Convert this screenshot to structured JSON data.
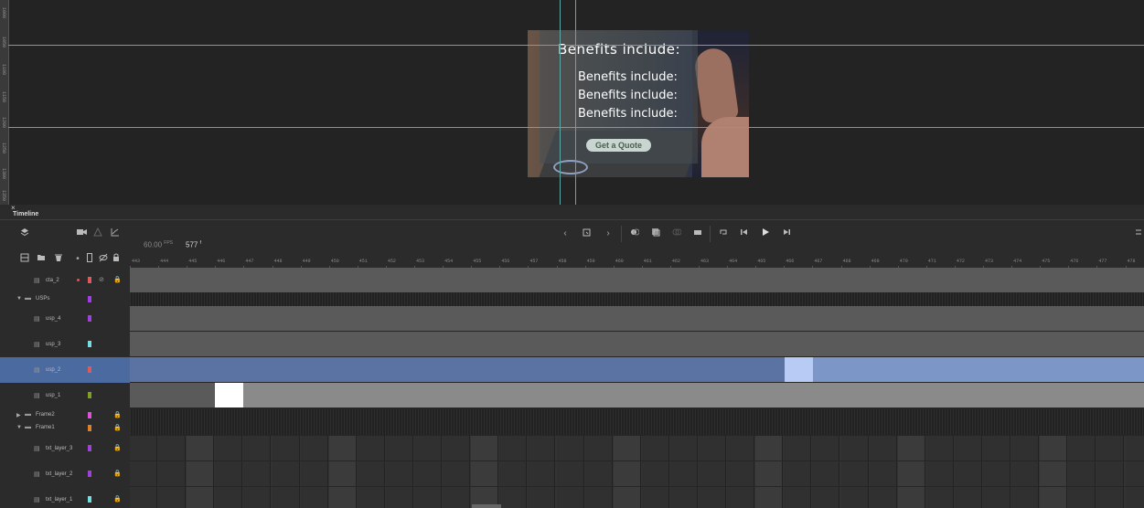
{
  "stage": {
    "ruler_marks": [
      "1000",
      "1050",
      "1100",
      "1150",
      "1200",
      "1250",
      "1300",
      "1350"
    ],
    "banner": {
      "title": "Benefits include:",
      "benefits": [
        "Benefits include:",
        "Benefits include:",
        "Benefits include:"
      ],
      "cta_label": "Get a Quote"
    }
  },
  "timeline": {
    "panel_title": "Timeline",
    "close_glyph": "×",
    "fps_value": "60.00",
    "fps_unit": "FPS",
    "current_frame": "577",
    "frame_unit": "f",
    "frame_numbers": [
      "443",
      "444",
      "445",
      "446",
      "447",
      "448",
      "449",
      "450",
      "451",
      "452",
      "453",
      "454",
      "455",
      "456",
      "457",
      "458",
      "459",
      "460",
      "461",
      "462",
      "463",
      "464",
      "465",
      "466",
      "467",
      "468",
      "469",
      "470",
      "471",
      "472",
      "473",
      "474",
      "475",
      "476",
      "477",
      "478"
    ],
    "layers": [
      {
        "name": "cta_2",
        "type": "layer",
        "color": "#e05858"
      },
      {
        "name": "USPs",
        "type": "folder",
        "color": "#a040e0"
      },
      {
        "name": "usp_4",
        "type": "layer",
        "color": "#a040e0"
      },
      {
        "name": "usp_3",
        "type": "layer",
        "color": "#70e0e0"
      },
      {
        "name": "usp_2",
        "type": "layer",
        "color": "#e05858"
      },
      {
        "name": "usp_1",
        "type": "layer",
        "color": "#80a020"
      },
      {
        "name": "Frame2",
        "type": "folder",
        "color": "#e050e0"
      },
      {
        "name": "Frame1",
        "type": "folder",
        "color": "#e08020"
      },
      {
        "name": "txt_layer_3",
        "type": "layer",
        "color": "#a040e0"
      },
      {
        "name": "txt_layer_2",
        "type": "layer",
        "color": "#a040e0"
      },
      {
        "name": "txt_layer_1",
        "type": "layer",
        "color": "#70e0e0"
      }
    ]
  }
}
